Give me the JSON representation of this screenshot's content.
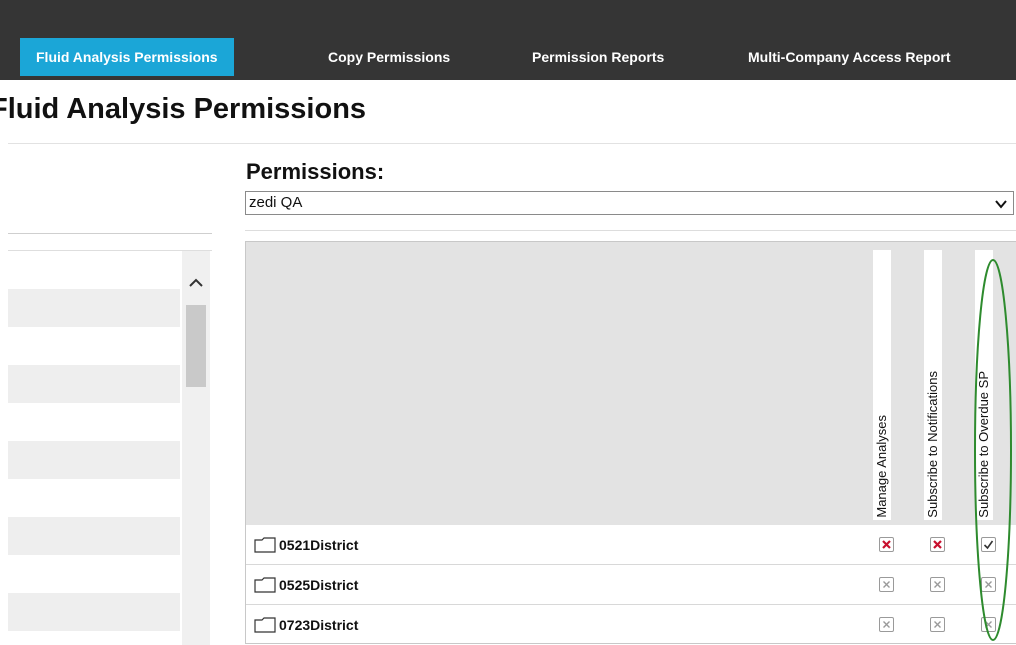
{
  "nav": {
    "tabs": [
      {
        "label": "Fluid Analysis Permissions",
        "active": true
      },
      {
        "label": "Copy Permissions",
        "active": false
      },
      {
        "label": "Permission Reports",
        "active": false
      },
      {
        "label": "Multi-Company Access Report",
        "active": false
      }
    ]
  },
  "page": {
    "title": "Fluid Analysis Permissions"
  },
  "permissions": {
    "label": "Permissions:",
    "selected": "zedi QA",
    "columns": [
      "Manage Analyses",
      "Subscribe to Notifications",
      "Subscribe to Overdue SP"
    ],
    "rows": [
      {
        "name": "0521District",
        "states": [
          "deny",
          "deny",
          "allow"
        ]
      },
      {
        "name": "0525District",
        "states": [
          "unset",
          "unset",
          "unset"
        ]
      },
      {
        "name": "0723District",
        "states": [
          "unset",
          "unset",
          "unset"
        ]
      }
    ]
  },
  "colors": {
    "nav_bg": "#353535",
    "active_tab": "#1ba6d7",
    "deny": "#c8102e",
    "highlight": "#2e8b2e"
  },
  "icons": [
    "folder-icon",
    "chevron-down-icon",
    "chevron-up-icon",
    "check-icon",
    "x-icon"
  ]
}
